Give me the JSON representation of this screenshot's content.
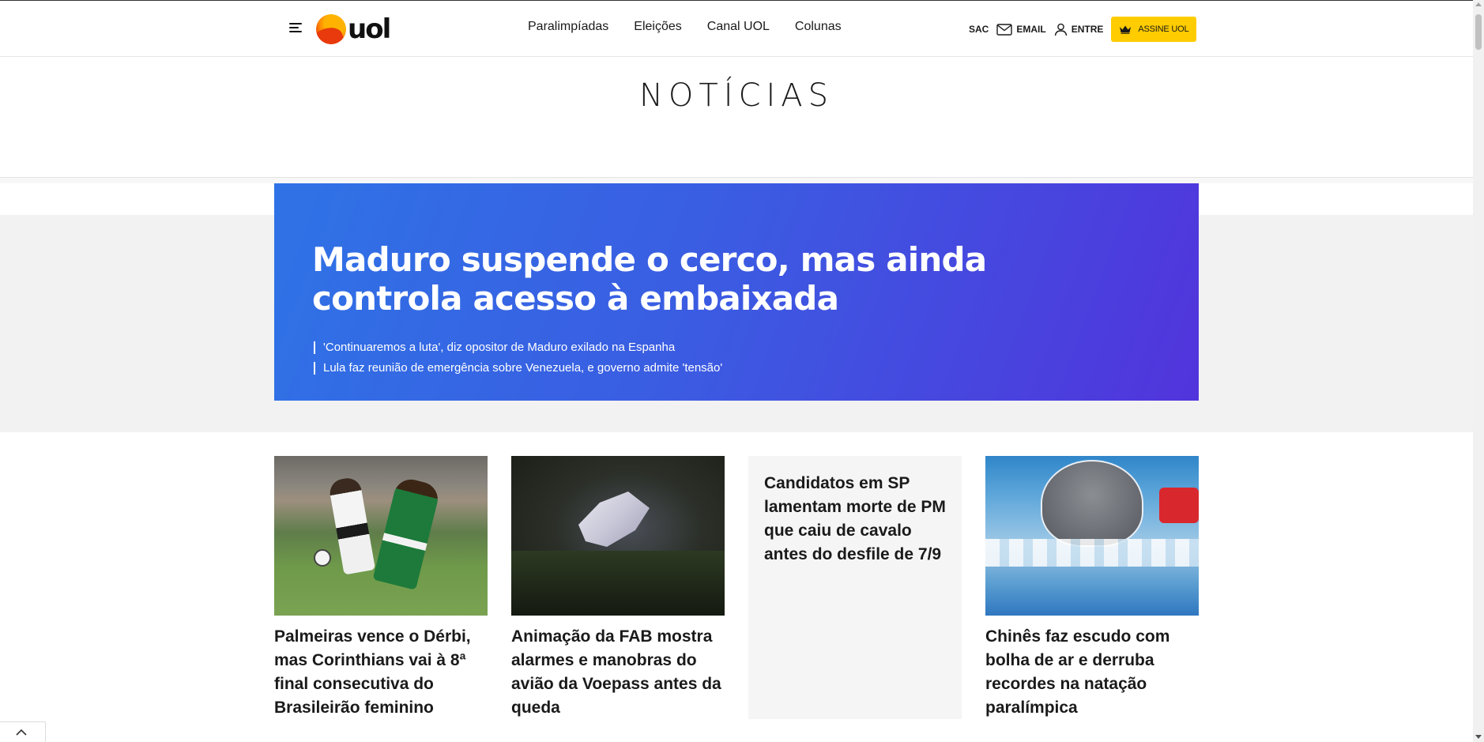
{
  "header": {
    "logo_text": "uol",
    "nav": [
      {
        "label": "Paralimpíadas"
      },
      {
        "label": "Eleições"
      },
      {
        "label": "Canal UOL"
      },
      {
        "label": "Colunas"
      }
    ],
    "utility": {
      "sac_label": "SAC",
      "email_label": "EMAIL",
      "login_label": "ENTRE",
      "subscribe_label": "ASSINE UOL"
    }
  },
  "section": {
    "title": "NOTÍCIAS"
  },
  "hero": {
    "headline": "Maduro suspende o cerco, mas ainda controla acesso à embaixada",
    "related": [
      "'Continuaremos a luta', diz opositor de Maduro exilado na Espanha",
      "Lula faz reunião de emergência sobre Venezuela, e governo admite 'tensão'"
    ]
  },
  "cards": [
    {
      "title": "Palmeiras vence o Dérbi, mas Corinthians vai à 8ª final consecutiva do Brasileirão feminino"
    },
    {
      "title": "Animação da FAB mostra alarmes e manobras do avião da Voepass antes da queda"
    },
    {
      "title": "Candidatos em SP lamentam morte de PM que caiu de cavalo antes do desfile de 7/9"
    },
    {
      "title": "Chinês faz escudo com bolha de ar e derruba recordes na natação paralímpica"
    }
  ],
  "colors": {
    "accent_yellow": "#ffcc00",
    "hero_gradient_start": "#2f73e6",
    "hero_gradient_end": "#5134dc",
    "band_grey": "#f2f2f2"
  },
  "icons": [
    "hamburger-icon",
    "mail-icon",
    "user-icon",
    "crown-icon",
    "chevron-up-icon"
  ]
}
